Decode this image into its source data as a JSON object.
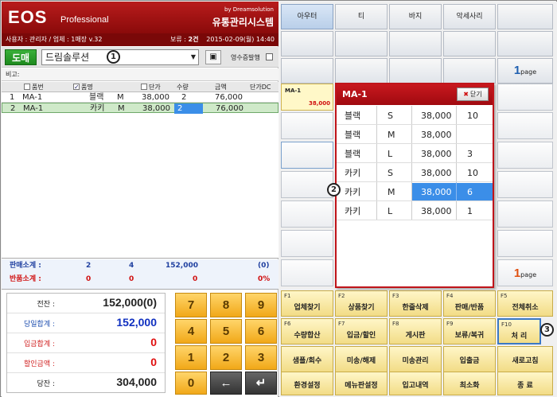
{
  "header": {
    "logo": "EOS",
    "logo_sub": "Professional",
    "by": "by Dreamsolution",
    "system": "유통관리시스템"
  },
  "infobar": {
    "user": "사용자 : 관리자 / 업체 : 1매장 v.32",
    "hold_label": "보류 :",
    "hold_value": "2건",
    "date": "2015-02-09(월) 14:40"
  },
  "customer": {
    "mode": "도매",
    "selected": "드림솔루션",
    "receipt_label": "영수증발행"
  },
  "memo_label": "비고:",
  "table": {
    "columns": [
      "품번",
      "품명",
      "단가",
      "수량",
      "금액",
      "단가DC"
    ],
    "rows": [
      {
        "no": "1",
        "code": "MA-1",
        "color": "블랙",
        "size": "M",
        "price": "38,000",
        "qty": "2",
        "amount": "76,000"
      },
      {
        "no": "2",
        "code": "MA-1",
        "color": "카키",
        "size": "M",
        "price": "38,000",
        "qty": "2",
        "amount": "76,000"
      }
    ]
  },
  "subtotals": {
    "sales": {
      "label": "판매소계 :",
      "a": "2",
      "b": "4",
      "c": "152,000",
      "d": "(0)"
    },
    "returns": {
      "label": "반품소계 :",
      "a": "0",
      "b": "0",
      "c": "0",
      "d": "0%"
    }
  },
  "summary": [
    {
      "label": "전잔 :",
      "value": "152,000(0)"
    },
    {
      "label": "당일합계 :",
      "value": "152,000"
    },
    {
      "label": "입금합계 :",
      "value": "0"
    },
    {
      "label": "할인금액 :",
      "value": "0"
    },
    {
      "label": "당잔 :",
      "value": "304,000"
    }
  ],
  "keypad": [
    "7",
    "8",
    "9",
    "4",
    "5",
    "6",
    "1",
    "2",
    "3",
    "0",
    "←",
    "↵"
  ],
  "categories": [
    "아우터",
    "티",
    "바지",
    "악세사리"
  ],
  "page_top": {
    "num": "1",
    "label": "page"
  },
  "page_bottom": {
    "num": "1",
    "label": "page"
  },
  "product": {
    "name": "MA-1",
    "price": "38,000"
  },
  "functions": [
    {
      "key": "F1",
      "label": "업체찾기"
    },
    {
      "key": "F2",
      "label": "상품찾기"
    },
    {
      "key": "F3",
      "label": "한줄삭제"
    },
    {
      "key": "F4",
      "label": "판매/반품"
    },
    {
      "key": "F5",
      "label": "전체취소"
    },
    {
      "key": "F6",
      "label": "수량합산"
    },
    {
      "key": "F7",
      "label": "입금/할인"
    },
    {
      "key": "F8",
      "label": "게시판"
    },
    {
      "key": "F9",
      "label": "보류/복귀"
    },
    {
      "key": "F10",
      "label": "처  리"
    },
    {
      "key": "",
      "label": "샘플/회수"
    },
    {
      "key": "",
      "label": "미송/해제"
    },
    {
      "key": "",
      "label": "미송관리"
    },
    {
      "key": "",
      "label": "입출금"
    },
    {
      "key": "",
      "label": "새로고침"
    },
    {
      "key": "",
      "label": "환경설정"
    },
    {
      "key": "",
      "label": "메뉴판설정"
    },
    {
      "key": "",
      "label": "입고내역"
    },
    {
      "key": "",
      "label": "최소화"
    },
    {
      "key": "",
      "label": "종  료"
    }
  ],
  "popup": {
    "title": "MA-1",
    "close_label": "닫기",
    "options": [
      {
        "color": "블랙",
        "size": "S",
        "price": "38,000",
        "qty": "10"
      },
      {
        "color": "블랙",
        "size": "M",
        "price": "38,000",
        "qty": ""
      },
      {
        "color": "블랙",
        "size": "L",
        "price": "38,000",
        "qty": "3"
      },
      {
        "color": "카키",
        "size": "S",
        "price": "38,000",
        "qty": "10"
      },
      {
        "color": "카키",
        "size": "M",
        "price": "38,000",
        "qty": "6"
      },
      {
        "color": "카키",
        "size": "L",
        "price": "38,000",
        "qty": "1"
      }
    ]
  },
  "callouts": [
    "1",
    "2",
    "3"
  ]
}
